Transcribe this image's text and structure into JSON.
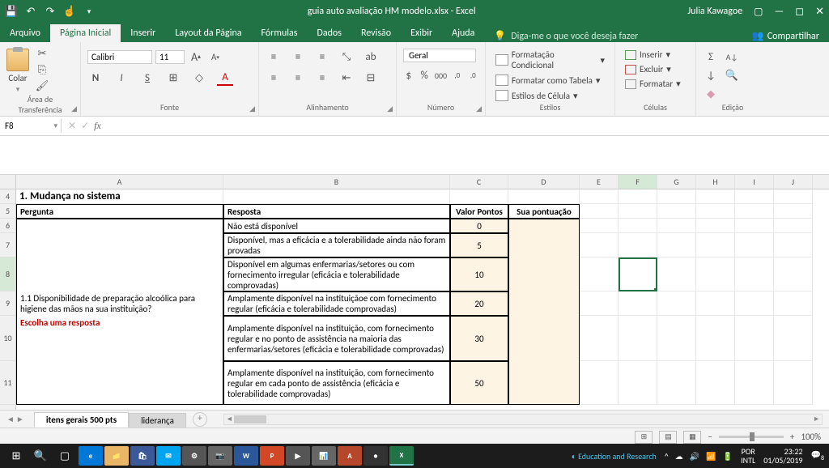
{
  "titlebar": {
    "filename": "guia auto avaliação HM modelo.xlsx - Excel",
    "user": "Julia Kawagoe"
  },
  "tabs": {
    "file": "Arquivo",
    "home": "Página Inicial",
    "insert": "Inserir",
    "layout": "Layout da Página",
    "formulas": "Fórmulas",
    "data": "Dados",
    "review": "Revisão",
    "view": "Exibir",
    "help": "Ajuda",
    "tellme": "Diga-me o que você deseja fazer",
    "share": "Compartilhar"
  },
  "ribbon": {
    "clipboard": {
      "paste": "Colar",
      "label": "Área de Transferência"
    },
    "font": {
      "name": "Calibri",
      "size": "11",
      "label": "Fonte",
      "bold": "N",
      "italic": "I",
      "underline": "S"
    },
    "alignment": {
      "label": "Alinhamento"
    },
    "number": {
      "format": "Geral",
      "label": "Número"
    },
    "styles": {
      "cond": "Formatação Condicional",
      "table": "Formatar como Tabela",
      "cell": "Estilos de Célula",
      "label": "Estilos"
    },
    "cells": {
      "insert": "Inserir",
      "delete": "Excluir",
      "format": "Formatar",
      "label": "Células"
    },
    "editing": {
      "label": "Edição"
    }
  },
  "namebox": "F8",
  "columns": [
    "A",
    "B",
    "C",
    "D",
    "E",
    "F",
    "G",
    "H",
    "I",
    "J"
  ],
  "rows": [
    "4",
    "5",
    "6",
    "7",
    "8",
    "9",
    "10",
    "11"
  ],
  "sheet": {
    "section_title": "1. Mudança no sistema",
    "h_pergunta": "Pergunta",
    "h_resposta": "Resposta",
    "h_valor": "Valor Pontos",
    "h_sua": "Sua pontuação",
    "q1": "1.1 Disponibilidade de preparação alcoólica para higiene das mãos na sua instituição?",
    "q1_instruct": "Escolha uma resposta",
    "r1": "Não está disponível",
    "r2": "Disponível, mas a eficácia e a tolerabilidade ainda não foram provadas",
    "r3": "Disponível em algumas enfermarias/setores ou com fornecimento irregular (eficácia e tolerabilidade comprovadas)",
    "r4": "Amplamente disponível na instituiçãoe com fornecimento regular (eficácia e tolerabilidade comprovadas)",
    "r5": "Amplamente disponível na instituição, com fornecimento regular e no ponto de assistência na maioria das enfermarias/setores (eficácia e tolerabilidade comprovadas)",
    "r6": "Amplamente disponível na instituição, com fornecimento regular em cada ponto de assistência (eficácia e tolerabilidade comprovadas)",
    "v1": "0",
    "v2": "5",
    "v3": "10",
    "v4": "20",
    "v5": "30",
    "v6": "50"
  },
  "sheettabs": {
    "t1": "itens gerais 500 pts",
    "t2": "liderança"
  },
  "statusbar": {
    "zoom": "100%"
  },
  "taskbar": {
    "edu": "Education and Research",
    "lang1": "POR",
    "lang2": "INTL",
    "time": "23:22",
    "date": "01/05/2019",
    "notif": "8"
  }
}
